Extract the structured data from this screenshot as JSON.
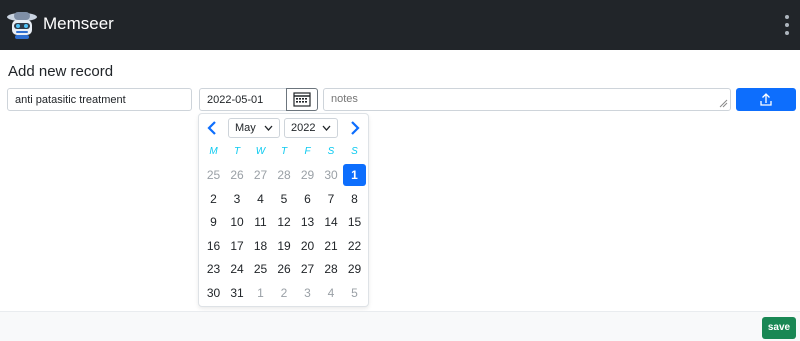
{
  "app": {
    "title": "Memseer"
  },
  "page": {
    "heading": "Add new record"
  },
  "form": {
    "name_value": "anti patasitic treatment",
    "date_value": "2022-05-01",
    "notes_placeholder": "notes"
  },
  "datepicker": {
    "month": "May",
    "year": "2022",
    "weekdays": [
      "M",
      "T",
      "W",
      "T",
      "F",
      "S",
      "S"
    ],
    "weeks": [
      [
        {
          "d": "25",
          "m": true
        },
        {
          "d": "26",
          "m": true
        },
        {
          "d": "27",
          "m": true
        },
        {
          "d": "28",
          "m": true
        },
        {
          "d": "29",
          "m": true
        },
        {
          "d": "30",
          "m": true
        },
        {
          "d": "1",
          "sel": true
        }
      ],
      [
        {
          "d": "2"
        },
        {
          "d": "3"
        },
        {
          "d": "4"
        },
        {
          "d": "5"
        },
        {
          "d": "6"
        },
        {
          "d": "7"
        },
        {
          "d": "8"
        }
      ],
      [
        {
          "d": "9"
        },
        {
          "d": "10"
        },
        {
          "d": "11"
        },
        {
          "d": "12"
        },
        {
          "d": "13"
        },
        {
          "d": "14"
        },
        {
          "d": "15"
        }
      ],
      [
        {
          "d": "16"
        },
        {
          "d": "17"
        },
        {
          "d": "18"
        },
        {
          "d": "19"
        },
        {
          "d": "20"
        },
        {
          "d": "21"
        },
        {
          "d": "22"
        }
      ],
      [
        {
          "d": "23"
        },
        {
          "d": "24"
        },
        {
          "d": "25"
        },
        {
          "d": "26"
        },
        {
          "d": "27"
        },
        {
          "d": "28"
        },
        {
          "d": "29"
        }
      ],
      [
        {
          "d": "30"
        },
        {
          "d": "31"
        },
        {
          "d": "1",
          "m": true
        },
        {
          "d": "2",
          "m": true
        },
        {
          "d": "3",
          "m": true
        },
        {
          "d": "4",
          "m": true
        },
        {
          "d": "5",
          "m": true
        }
      ]
    ]
  },
  "footer": {
    "save_label": "save"
  },
  "icons": {
    "logo": "robot-logo-icon",
    "menu": "kebab-menu-icon",
    "calendar": "calendar-icon",
    "upload": "upload-icon",
    "prev": "chevron-left-icon",
    "next": "chevron-right-icon"
  },
  "colors": {
    "navbar": "#212529",
    "primary": "#0d6efd",
    "success": "#198754",
    "weekday": "#0dcaf0"
  }
}
